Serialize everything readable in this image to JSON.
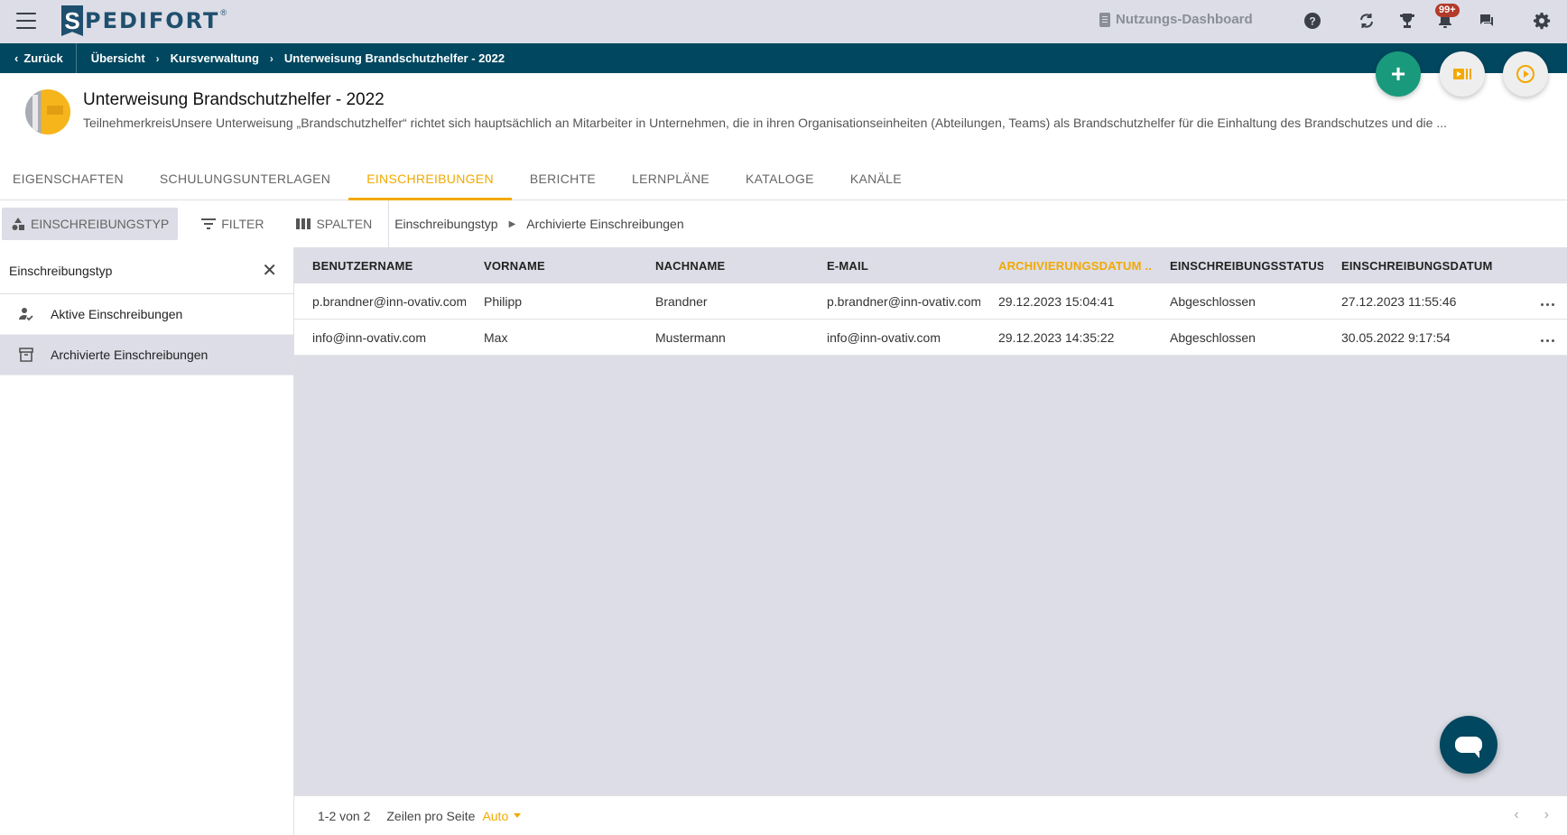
{
  "topbar": {
    "logo_letter": "S",
    "logo_text": "PEDIFORT",
    "logo_reg": "®",
    "dashboard_label": "Nutzungs-Dashboard",
    "notification_badge": "99+"
  },
  "breadcrumb": {
    "back_label": "Zurück",
    "items": [
      "Übersicht",
      "Kursverwaltung",
      "Unterweisung Brandschutzhelfer - 2022"
    ]
  },
  "course": {
    "title": "Unterweisung Brandschutzhelfer - 2022",
    "description": "TeilnehmerkreisUnsere Unterweisung „Brandschutzhelfer“ richtet sich hauptsächlich an Mitarbeiter in Unternehmen, die in ihren Organisationseinheiten (Abteilungen, Teams) als Brandschutzhelfer für die Einhaltung des Brandschutzes und die ..."
  },
  "tabs": [
    "EIGENSCHAFTEN",
    "SCHULUNGSUNTERLAGEN",
    "EINSCHREIBUNGEN",
    "BERICHTE",
    "LERNPLÄNE",
    "KATALOGE",
    "KANÄLE"
  ],
  "active_tab": "EINSCHREIBUNGEN",
  "toolbar": {
    "type_btn": "EINSCHREIBUNGSTYP",
    "filter_btn": "FILTER",
    "columns_btn": "SPALTEN",
    "crumb_root": "Einschreibungstyp",
    "crumb_current": "Archivierte Einschreibungen"
  },
  "panel": {
    "title": "Einschreibungstyp",
    "items": [
      "Aktive Einschreibungen",
      "Archivierte Einschreibungen"
    ],
    "selected": "Archivierte Einschreibungen"
  },
  "table": {
    "headers": [
      "BENUTZERNAME",
      "VORNAME",
      "NACHNAME",
      "E-MAIL",
      "ARCHIVIERUNGSDATUM ...",
      "EINSCHREIBUNGSSTATUS",
      "EINSCHREIBUNGSDATUM"
    ],
    "rows": [
      [
        "p.brandner@inn-ovativ.com",
        "Philipp",
        "Brandner",
        "p.brandner@inn-ovativ.com",
        "29.12.2023 15:04:41",
        "Abgeschlossen",
        "27.12.2023 11:55:46"
      ],
      [
        "info@inn-ovativ.com",
        "Max",
        "Mustermann",
        "info@inn-ovativ.com",
        "29.12.2023 14:35:22",
        "Abgeschlossen",
        "30.05.2022 9:17:54"
      ]
    ]
  },
  "footer": {
    "range": "1-2 von 2",
    "rows_label": "Zeilen pro Seite",
    "rows_value": "Auto"
  },
  "colors": {
    "accent": "#f2a900",
    "navbar": "#00475f",
    "fab_green": "#1a9a7c",
    "badge": "#b33a2a"
  }
}
